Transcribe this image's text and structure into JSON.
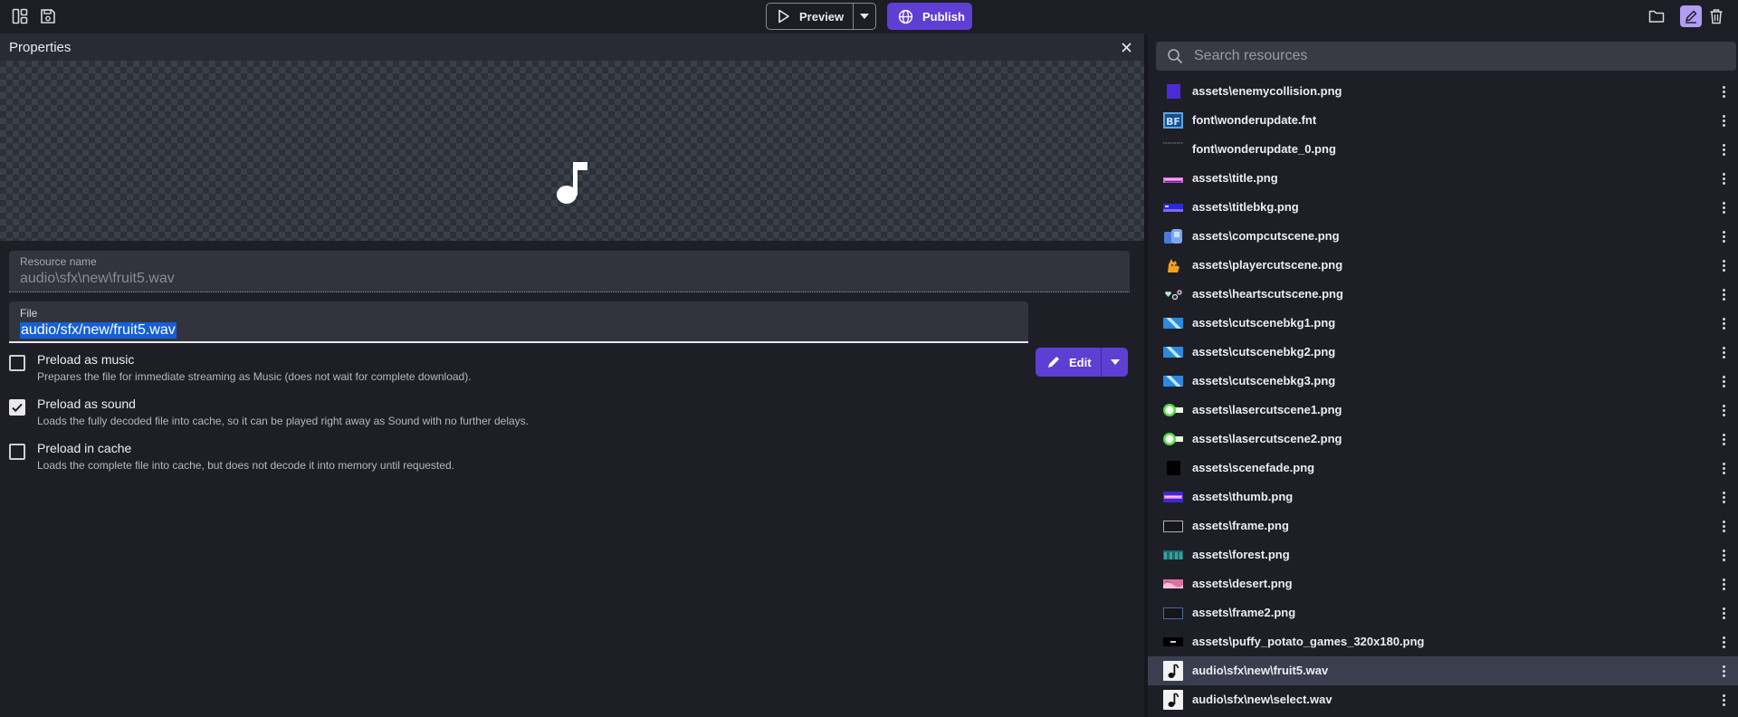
{
  "toolbar": {
    "preview_label": "Preview",
    "publish_label": "Publish",
    "accent_color": "#5f3fd3"
  },
  "properties": {
    "title": "Properties",
    "resource_name_label": "Resource name",
    "resource_name_value": "audio\\sfx\\new\\fruit5.wav",
    "file_label": "File",
    "file_value": "audio/sfx/new/fruit5.wav",
    "edit_label": "Edit",
    "options": [
      {
        "title": "Preload as music",
        "description": "Prepares the file for immediate streaming as Music (does not wait for complete download).",
        "checked": false
      },
      {
        "title": "Preload as sound",
        "description": "Loads the fully decoded file into cache, so it can be played right away as Sound with no further delays.",
        "checked": true
      },
      {
        "title": "Preload in cache",
        "description": "Loads the complete file into cache, but does not decode it into memory until requested.",
        "checked": false
      }
    ]
  },
  "resources": {
    "search_placeholder": "Search resources",
    "items": [
      {
        "name": "assets\\enemycollision.png",
        "icon": "purple-square-thumb"
      },
      {
        "name": "font\\wonderupdate.fnt",
        "icon": "bitmap-font-thumb"
      },
      {
        "name": "font\\wonderupdate_0.png",
        "icon": "font-atlas-thumb"
      },
      {
        "name": "assets\\title.png",
        "icon": "title-thumb"
      },
      {
        "name": "assets\\titlebkg.png",
        "icon": "titlebkg-thumb"
      },
      {
        "name": "assets\\compcutscene.png",
        "icon": "computer-thumb"
      },
      {
        "name": "assets\\playercutscene.png",
        "icon": "cat-thumb"
      },
      {
        "name": "assets\\heartscutscene.png",
        "icon": "hearts-thumb"
      },
      {
        "name": "assets\\cutscenebkg1.png",
        "icon": "blue-stripe-thumb"
      },
      {
        "name": "assets\\cutscenebkg2.png",
        "icon": "blue-stripe-thumb"
      },
      {
        "name": "assets\\cutscenebkg3.png",
        "icon": "blue-stripe-thumb"
      },
      {
        "name": "assets\\lasercutscene1.png",
        "icon": "laser-thumb"
      },
      {
        "name": "assets\\lasercutscene2.png",
        "icon": "laser-thumb"
      },
      {
        "name": "assets\\scenefade.png",
        "icon": "black-square-thumb"
      },
      {
        "name": "assets\\thumb.png",
        "icon": "thumb-thumb"
      },
      {
        "name": "assets\\frame.png",
        "icon": "frame-thumb"
      },
      {
        "name": "assets\\forest.png",
        "icon": "forest-thumb"
      },
      {
        "name": "assets\\desert.png",
        "icon": "desert-thumb"
      },
      {
        "name": "assets\\frame2.png",
        "icon": "frame2-thumb"
      },
      {
        "name": "assets\\puffy_potato_games_320x180.png",
        "icon": "logo-thumb"
      },
      {
        "name": "audio\\sfx\\new\\fruit5.wav",
        "icon": "music-note-thumb",
        "selected": true
      },
      {
        "name": "audio\\sfx\\new\\select.wav",
        "icon": "music-note-thumb"
      }
    ]
  }
}
